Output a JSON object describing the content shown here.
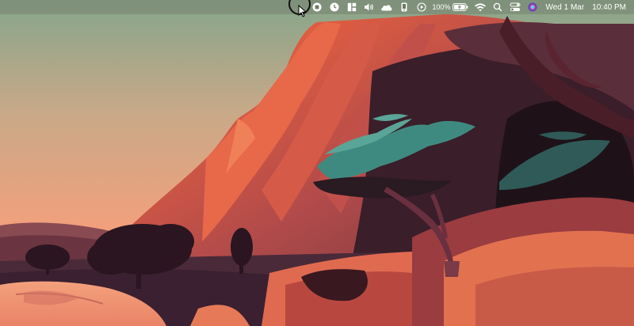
{
  "menubar": {
    "status_icons": [
      "stop-recording-icon",
      "clock-utility-icon",
      "window-layout-icon",
      "volume-icon",
      "cloud-weather-icon",
      "phone-icon",
      "play-circle-icon"
    ],
    "battery_percent": "100%",
    "battery_level": 1.0,
    "system_icons": [
      "wifi-icon",
      "search-icon",
      "control-center-icon",
      "siri-icon"
    ],
    "date": "Wed 1 Mar",
    "time": "10:40 PM"
  },
  "colors": {
    "menubar_text": "#ffffff",
    "sky_top": "#8ba88c",
    "sky_bottom": "#f0a07a",
    "cliff_orange": "#e8704a",
    "cliff_dark": "#2a1a22",
    "foliage_teal": "#3f8a80"
  }
}
